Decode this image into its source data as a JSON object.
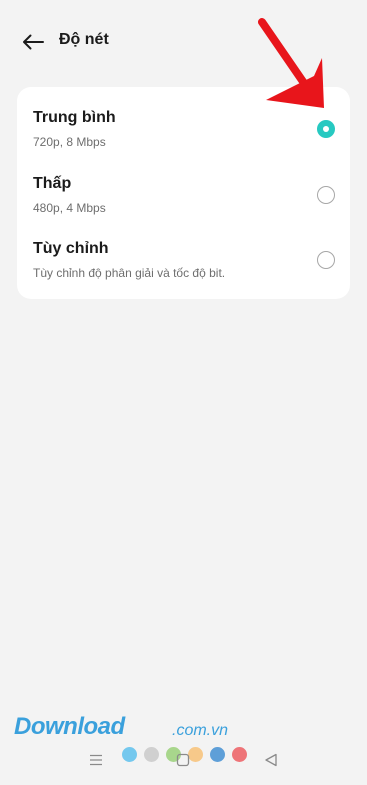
{
  "header": {
    "back_icon": "arrow-left-icon",
    "title": "Độ nét"
  },
  "options": [
    {
      "label": "Trung bình",
      "description": "720p, 8 Mbps",
      "selected": true
    },
    {
      "label": "Thấp",
      "description": "480p, 4 Mbps",
      "selected": false
    },
    {
      "label": "Tùy chỉnh",
      "description": "Tùy chỉnh độ phân giải và tốc độ bit.",
      "selected": false
    }
  ],
  "colors": {
    "accent": "#27c9c1",
    "annotation_arrow": "#e8151b",
    "watermark": "#3aa0dc"
  },
  "watermark": {
    "brand": "Download",
    "domain": ".com.vn",
    "dot_colors": [
      "#74c8ee",
      "#d0d0d0",
      "#a8d68c",
      "#f7c98a",
      "#5e9fd8",
      "#ee7478"
    ]
  },
  "nav_bar": {
    "menu_icon": "menu-icon",
    "home_icon": "home-square-icon",
    "back_icon": "back-triangle-icon"
  }
}
